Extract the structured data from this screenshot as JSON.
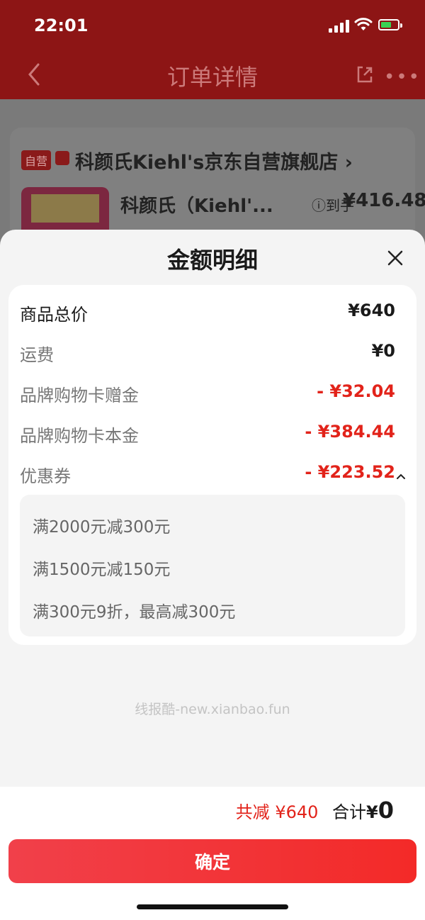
{
  "status_bar": {
    "time": "22:01"
  },
  "background": {
    "nav_title": "订单详情",
    "store_tag": "自营",
    "store_name": "科颜氏Kiehl's京东自营旗舰店 ›",
    "product_name": "科颜氏（Kiehl'...",
    "price_label": "ⓘ到手",
    "price": "¥416.48"
  },
  "sheet": {
    "title": "金额明细",
    "rows": [
      {
        "label": "商品总价",
        "value": "¥640"
      },
      {
        "label": "运费",
        "value": "¥0"
      },
      {
        "label": "品牌购物卡赠金",
        "value": "- ¥32.04"
      },
      {
        "label": "品牌购物卡本金",
        "value": "- ¥384.44"
      },
      {
        "label": "优惠券",
        "value": "- ¥223.52"
      }
    ],
    "coupons": [
      "满2000元减300元",
      "满1500元减150元",
      "满300元9折，最高减300元"
    ],
    "watermark": "线报酷-new.xianbao.fun"
  },
  "footer": {
    "save_label": "共减",
    "save_value": "¥640",
    "total_label": "合计",
    "total_symbol": "¥",
    "total_value": "0",
    "confirm_label": "确定"
  },
  "colors": {
    "accent_red": "#e2231a",
    "button_red": "#f32a28",
    "battery_green": "#39d353"
  }
}
